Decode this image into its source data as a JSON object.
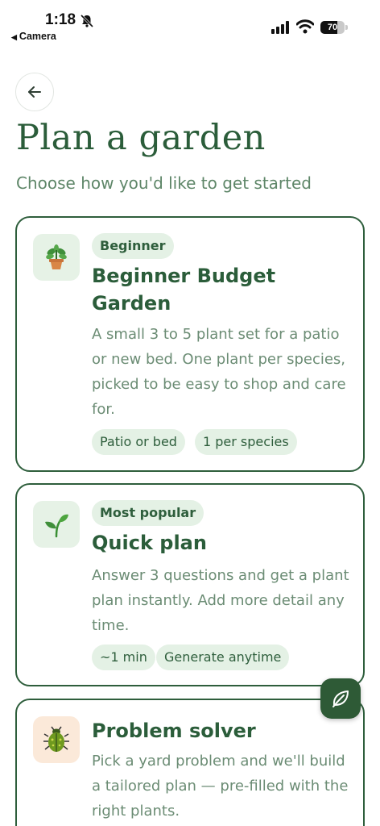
{
  "status_bar": {
    "time": "1:18",
    "back_app": "Camera",
    "battery": "70"
  },
  "header": {
    "title": "Plan a garden",
    "subtitle": "Choose how you'd like to get started"
  },
  "cards": [
    {
      "icon": "potted-plant-icon",
      "badge": "Beginner",
      "title": "Beginner Budget Garden",
      "description": "A small 3 to 5 plant set for a patio or new bed. One plant per species, picked to be easy to shop and care for.",
      "tags": [
        "Patio or bed",
        "1 per species"
      ]
    },
    {
      "icon": "seedling-icon",
      "badge": "Most popular",
      "title": "Quick plan",
      "description": "Answer 3 questions and get a plant plan instantly. Add more detail any time.",
      "tags": [
        "~1 min",
        "Generate anytime"
      ]
    },
    {
      "icon": "beetle-icon",
      "title": "Problem solver",
      "description": "Pick a yard problem and we'll build a tailored plan — pre-filled with the right plants."
    }
  ],
  "fab": {
    "icon": "leaf-icon"
  },
  "colors": {
    "primary": "#2e5e3c",
    "badge_bg": "#e4f1e5",
    "muted_text": "#6b8c74"
  }
}
